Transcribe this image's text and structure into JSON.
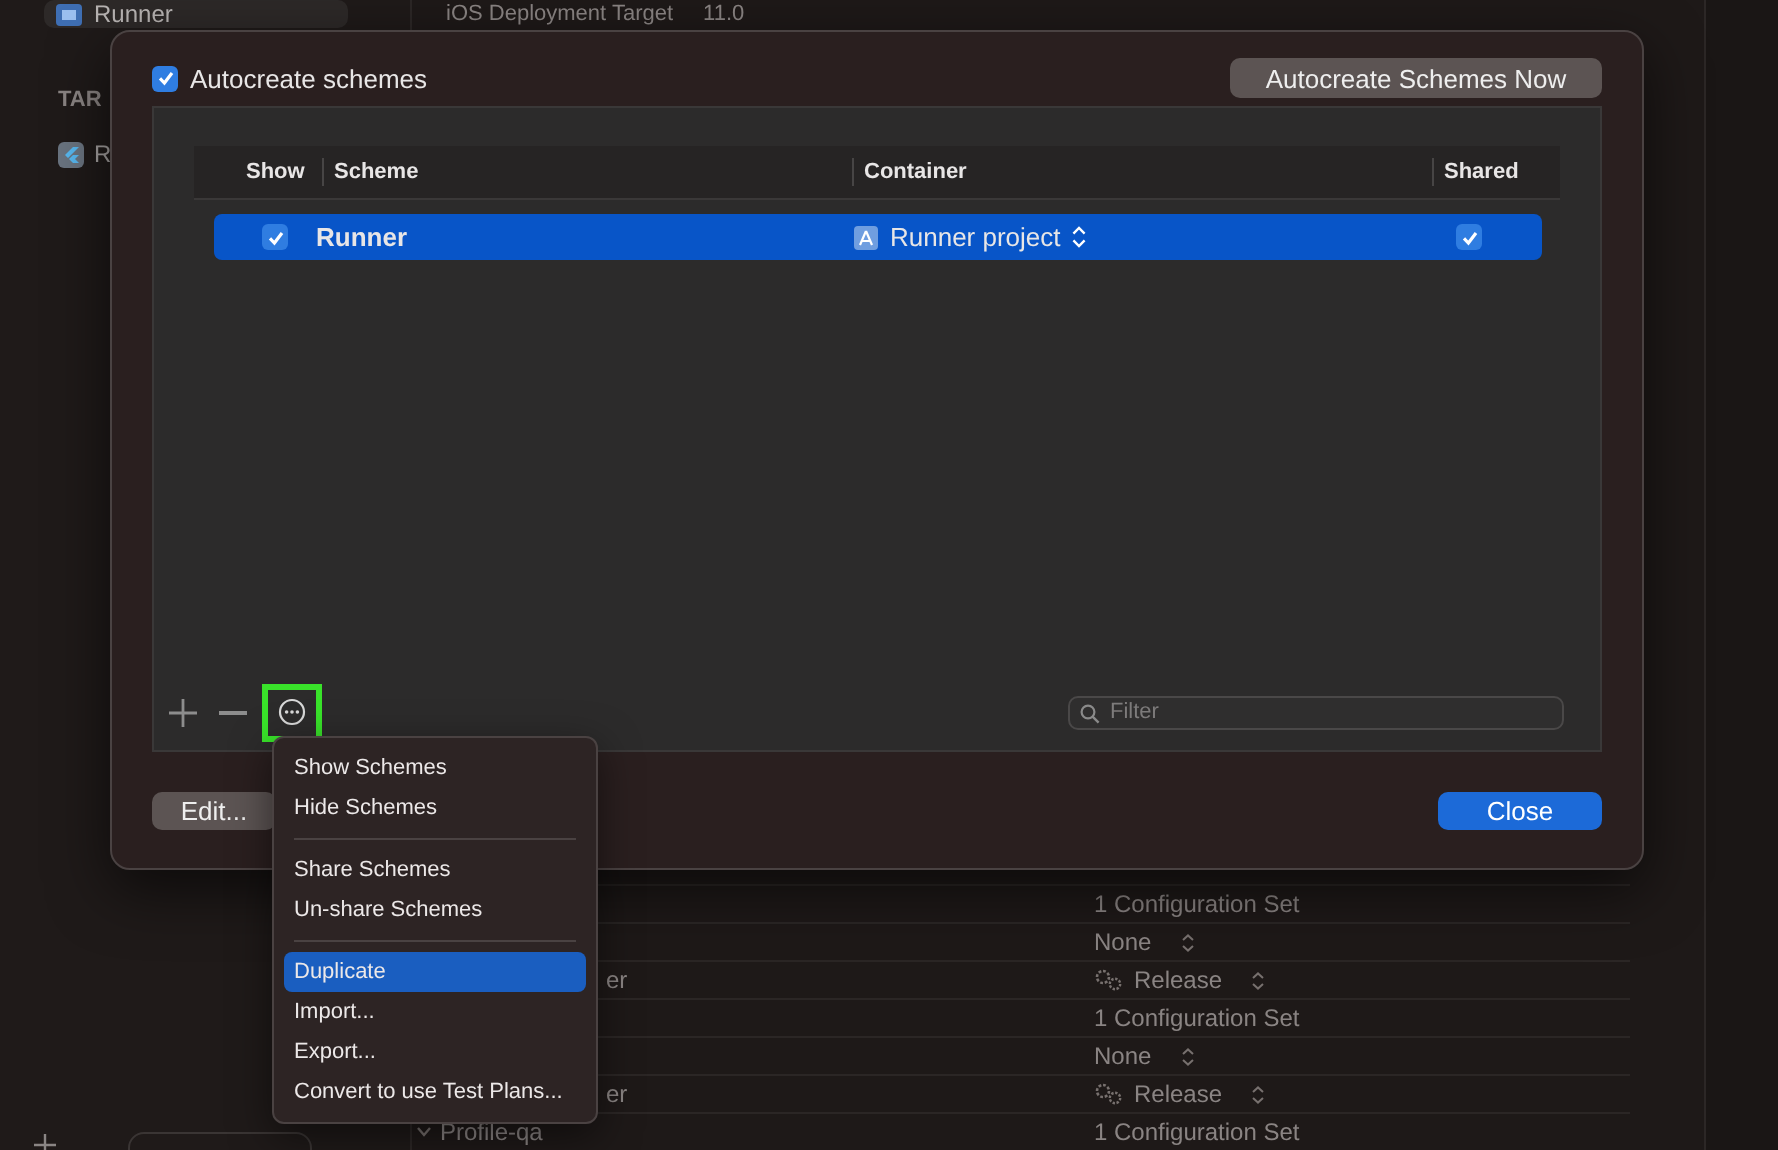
{
  "background": {
    "sidebar": {
      "project_item": "Runner",
      "section_heading": "TAR",
      "target_item": "R"
    },
    "build_setting": {
      "name": "iOS Deployment Target",
      "value": "11.0"
    },
    "rows": [
      {
        "kind": "text",
        "value": "1 Configuration Set"
      },
      {
        "kind": "popup",
        "value": "None"
      },
      {
        "kind": "config",
        "label": "er",
        "value": "Release"
      },
      {
        "kind": "text",
        "value": "1 Configuration Set"
      },
      {
        "kind": "popup",
        "value": "None"
      },
      {
        "kind": "config",
        "label": "er",
        "value": "Release"
      },
      {
        "kind": "text",
        "label": "Profile-qa",
        "expanded": true,
        "value": "1 Configuration Set"
      }
    ]
  },
  "dialog": {
    "autocreate": {
      "label": "Autocreate schemes",
      "checked": true
    },
    "autocreate_now_button": "Autocreate Schemes Now",
    "table": {
      "columns": [
        "Show",
        "Scheme",
        "Container",
        "Shared"
      ],
      "rows": [
        {
          "show": true,
          "scheme": "Runner",
          "container": "Runner project",
          "shared": true,
          "selected": true
        }
      ]
    },
    "toolbar": {
      "more_highlighted": true,
      "filter_placeholder": "Filter"
    },
    "buttons": {
      "edit": "Edit...",
      "close": "Close"
    }
  },
  "menu": {
    "sections": [
      [
        {
          "label": "Show Schemes",
          "selected": false
        },
        {
          "label": "Hide Schemes",
          "selected": false
        }
      ],
      [
        {
          "label": "Share Schemes",
          "selected": false
        },
        {
          "label": "Un-share Schemes",
          "selected": false
        }
      ],
      [
        {
          "label": "Duplicate",
          "selected": true
        },
        {
          "label": "Import...",
          "selected": false
        },
        {
          "label": "Export...",
          "selected": false
        },
        {
          "label": "Convert to use Test Plans...",
          "selected": false
        }
      ]
    ]
  }
}
